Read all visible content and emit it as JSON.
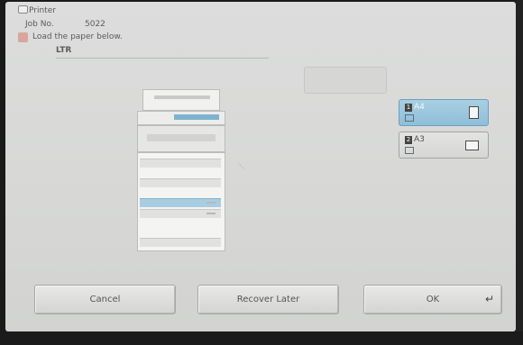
{
  "header": {
    "source_label": "Printer",
    "job_label": "Job No.",
    "job_number": "5022",
    "instruction": "Load the paper below.",
    "required_paper": "LTR"
  },
  "disabled_button": {
    "label": ""
  },
  "trays": [
    {
      "number": "1",
      "size": "A4",
      "selected": true,
      "orientation": "portrait"
    },
    {
      "number": "2",
      "size": "A3",
      "selected": false,
      "orientation": "landscape"
    }
  ],
  "actions": {
    "cancel_label": "Cancel",
    "recover_later_label": "Recover Later",
    "ok_label": "OK"
  },
  "colors": {
    "screen_background": "#d8d9d7",
    "selected_tray": "#98c6de",
    "text": "#5b5b5b"
  },
  "icons": {
    "source": "printer-icon",
    "warning": "warning-icon",
    "enter": "enter-icon"
  }
}
